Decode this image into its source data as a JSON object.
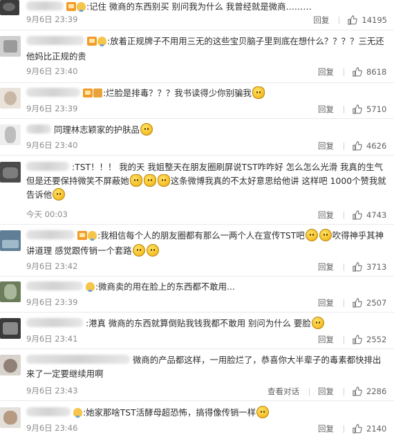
{
  "comments": [
    {
      "text_parts": [
        ":记住 微商的东西别买 别问我为什么 我曾经就是微商………"
      ],
      "time": "9月6日 23:39",
      "reply": "回复",
      "likes": "14195",
      "badges": [
        "vip",
        "bulb"
      ]
    },
    {
      "text_parts": ":放着正规牌子不用用三无的这些宝贝脑子里到底在想什么？？？？三无还他妈比正规的贵",
      "time": "9月6日 23:40",
      "reply": "回复",
      "likes": "8618",
      "badges": [
        "vip",
        "bulb"
      ]
    },
    {
      "text_parts": ":烂脸是排毒？？？我书读得少你别骗我",
      "time": "9月6日 23:39",
      "reply": "回复",
      "likes": "5710",
      "badges": [
        "vip",
        "gold"
      ]
    },
    {
      "text_parts": "同理林志颖家的护肤品",
      "time": "9月6日 23:40",
      "reply": "回复",
      "likes": "4626",
      "badges": []
    },
    {
      "text_parts": ":TST！！！ 我的天 我姐整天在朋友圈刷屏说TST咋咋好 怎么怎么光滑 我真的生气但是还要保持微笑不屏蔽她",
      "text_parts_2": "这条微博我真的不太好意思给他讲 这样吧 1000个赞我就告诉他",
      "time": "今天 00:03",
      "reply": "回复",
      "likes": "4743",
      "badges": []
    },
    {
      "text_parts": ":我相信每个人的朋友圈都有那么一两个人在宣传TST吧",
      "text_parts_2": "吹得神乎其神讲道理 感觉跟传销一个套路",
      "time": "9月6日 23:42",
      "reply": "回复",
      "likes": "3713",
      "badges": [
        "vip",
        "bulb"
      ]
    },
    {
      "text_parts": ":微商卖的用在脸上的东西都不敢用...",
      "time": "9月6日 23:39",
      "reply": "回复",
      "likes": "2507",
      "badges": [
        "bulb"
      ]
    },
    {
      "text_parts": ":港真 微商的东西就算倒贴我钱我都不敢用 别问为什么 要脸",
      "time": "9月6日 23:41",
      "reply": "回复",
      "likes": "2552",
      "badges": []
    },
    {
      "text_parts": "微商的产品都这样，一用脸烂了，恭喜你大半辈子的毒素都快排出来了一定要继续用啊",
      "time": "9月6日 23:43",
      "view": "查看对话",
      "reply": "回复",
      "likes": "2286",
      "badges": []
    },
    {
      "text_parts": ":她家那啥TST活酵母超恐怖，搞得像传销一样",
      "time": "9月6日 23:46",
      "reply": "回复",
      "likes": "2140",
      "badges": [
        "bulb"
      ]
    }
  ]
}
